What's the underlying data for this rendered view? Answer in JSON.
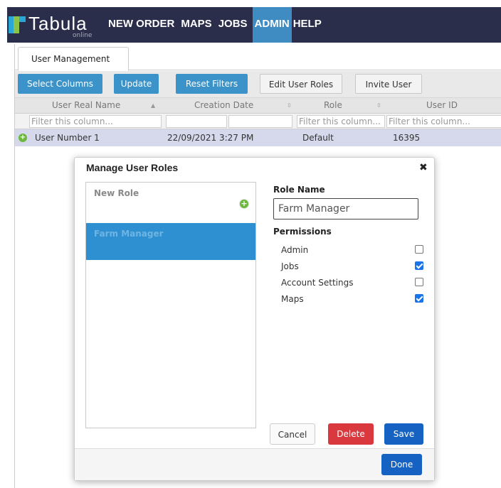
{
  "app": {
    "logo_text": "Tabula",
    "logo_sub": "online",
    "nav": [
      "NEW ORDER",
      "MAPS",
      "JOBS",
      "ADMIN",
      "HELP"
    ],
    "active_nav": "ADMIN"
  },
  "tab": {
    "label": "User Management"
  },
  "toolbar": {
    "select_columns": "Select Columns",
    "update": "Update",
    "reset_filters": "Reset Filters",
    "edit_user_roles": "Edit User Roles",
    "invite_user": "Invite User"
  },
  "grid": {
    "columns": [
      "User Real Name",
      "Creation Date",
      "Role",
      "User ID"
    ],
    "filter_placeholder": "Filter this column...",
    "rows": [
      {
        "name": "User Number 1",
        "created": "22/09/2021 3:27 PM",
        "role": "Default",
        "user_id": "16395"
      }
    ]
  },
  "modal": {
    "title": "Manage User Roles",
    "close": "✖",
    "new_role_label": "New Role",
    "roles": [
      "Farm Manager"
    ],
    "role_name_label": "Role Name",
    "role_name_value": "Farm Manager",
    "permissions_label": "Permissions",
    "permissions": [
      {
        "label": "Admin",
        "checked": false
      },
      {
        "label": "Jobs",
        "checked": true
      },
      {
        "label": "Account Settings",
        "checked": false
      },
      {
        "label": "Maps",
        "checked": true
      }
    ],
    "cancel": "Cancel",
    "delete": "Delete",
    "save": "Save",
    "done": "Done"
  },
  "colors": {
    "nav_bg": "#2b2e4a",
    "nav_active": "#3f8cc2",
    "toolbar_blue": "#3b93c9",
    "selected_row": "#d6d9ec",
    "role_selected": "#2e8fd1",
    "delete": "#d9393e",
    "primary": "#1662c3"
  }
}
